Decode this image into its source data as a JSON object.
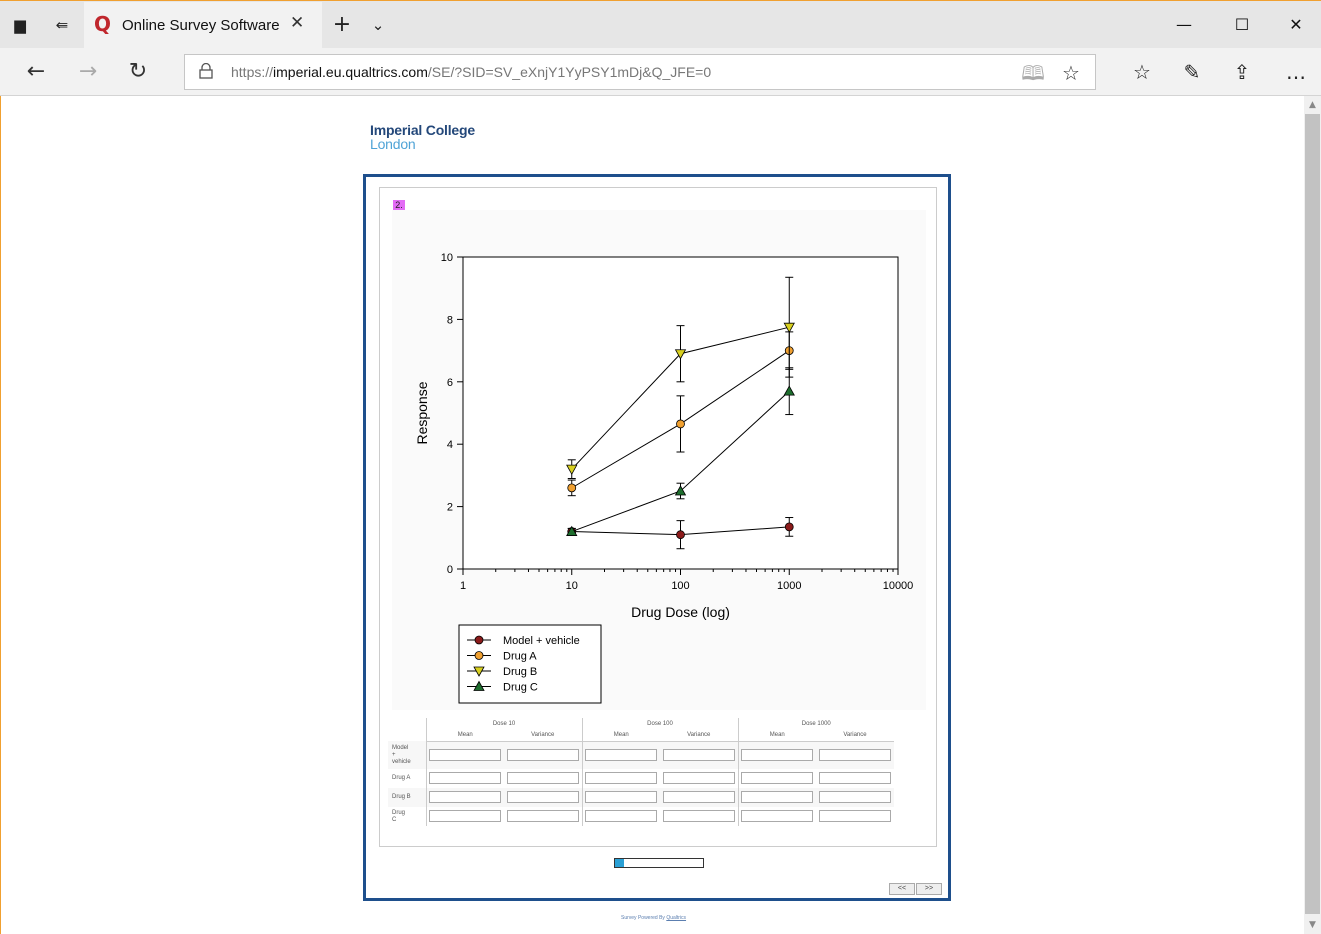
{
  "browser": {
    "tab_title": "Online Survey Software",
    "url_prefix": "https://",
    "url_host": "imperial.eu.qualtrics.com",
    "url_path": "/SE/?SID=SV_eXnjY1YyPSY1mDj&Q_JFE=0"
  },
  "page": {
    "logo_line1": "Imperial College",
    "logo_line2": "London",
    "question_number": "2.",
    "footer_text": "Survey Powered By",
    "footer_link": "Qualtrics",
    "progress": 0.1,
    "prev_button": "<<",
    "next_button": ">>"
  },
  "chart_data": {
    "type": "line",
    "xlabel": "Drug Dose (log)",
    "ylabel": "Response",
    "xscale": "log",
    "xlim": [
      1,
      10000
    ],
    "ylim": [
      0,
      10
    ],
    "xticks": [
      "1",
      "10",
      "100",
      "1000",
      "10000"
    ],
    "yticks": [
      "0",
      "2",
      "4",
      "6",
      "8",
      "10"
    ],
    "x": [
      10,
      100,
      1000
    ],
    "series": [
      {
        "name": "Model + vehicle",
        "color": "#8b1a1a",
        "marker": "circle",
        "values": [
          1.2,
          1.1,
          1.35
        ],
        "errors": [
          0.1,
          0.45,
          0.3
        ]
      },
      {
        "name": "Drug A",
        "color": "#f0a030",
        "marker": "circle",
        "values": [
          2.6,
          4.65,
          7.0
        ],
        "errors": [
          0.25,
          0.9,
          0.6
        ]
      },
      {
        "name": "Drug B",
        "color": "#d8d020",
        "marker": "triangle-down",
        "values": [
          3.2,
          6.9,
          7.75
        ],
        "errors": [
          0.3,
          0.9,
          1.6
        ]
      },
      {
        "name": "Drug C",
        "color": "#1e6e2e",
        "marker": "triangle-up",
        "values": [
          1.2,
          2.5,
          5.7
        ],
        "errors": [
          0.1,
          0.25,
          0.75
        ]
      }
    ],
    "legend": "bottom-left"
  },
  "matrix": {
    "doses": [
      "Dose 10",
      "Dose 100",
      "Dose 1000"
    ],
    "subcols": [
      "Mean",
      "Variance"
    ],
    "rows": [
      "Model + vehicle",
      "Drug A",
      "Drug B",
      "Drug C"
    ]
  }
}
